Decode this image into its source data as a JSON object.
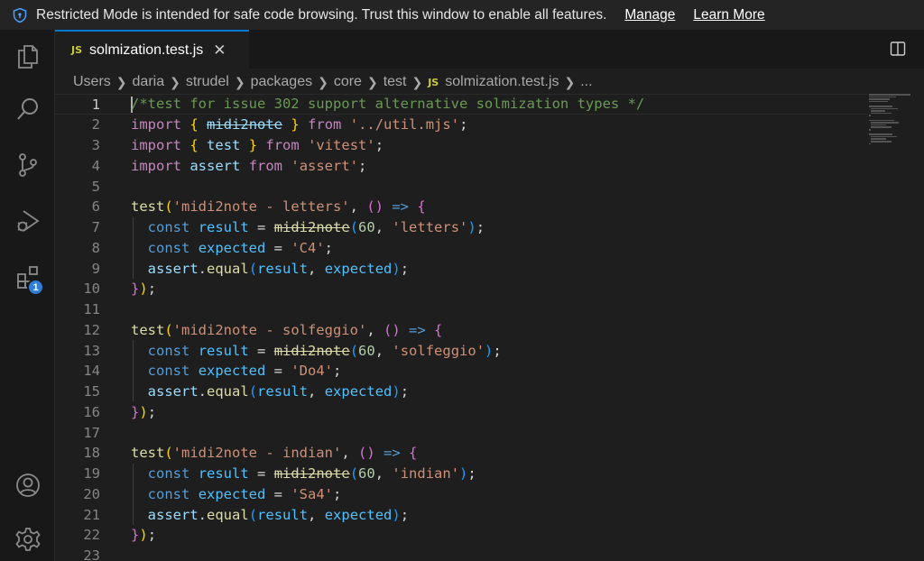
{
  "banner": {
    "message": "Restricted Mode is intended for safe code browsing. Trust this window to enable all features.",
    "manage_label": "Manage",
    "learn_more_label": "Learn More"
  },
  "activity_bar": {
    "extensions_badge": "1",
    "items": [
      "explorer-icon",
      "search-icon",
      "source-control-icon",
      "run-debug-icon",
      "extensions-icon",
      "accounts-icon",
      "settings-gear-icon"
    ]
  },
  "tab": {
    "icon_text": "JS",
    "filename": "solmization.test.js",
    "close_glyph": "✕"
  },
  "breadcrumb": {
    "items": [
      "Users",
      "daria",
      "strudel",
      "packages",
      "core",
      "test"
    ],
    "file_icon": "JS",
    "file": "solmization.test.js",
    "trailing": "..."
  },
  "editor": {
    "line_numbers": [
      "1",
      "2",
      "3",
      "4",
      "5",
      "6",
      "7",
      "8",
      "9",
      "10",
      "11",
      "12",
      "13",
      "14",
      "15",
      "16",
      "17",
      "18",
      "19",
      "20",
      "21",
      "22",
      "23"
    ],
    "lines": [
      [
        [
          "c-cmt",
          "/*test for issue 302 support alternative solmization types */"
        ]
      ],
      [
        [
          "c-kw",
          "import"
        ],
        [
          "c-pl",
          " "
        ],
        [
          "c-br1",
          "{"
        ],
        [
          "c-pl",
          " "
        ],
        [
          "c-var strike",
          "midi2note"
        ],
        [
          "c-pl",
          " "
        ],
        [
          "c-br1",
          "}"
        ],
        [
          "c-pl",
          " "
        ],
        [
          "c-kw",
          "from"
        ],
        [
          "c-pl",
          " "
        ],
        [
          "c-str",
          "'../util.mjs'"
        ],
        [
          "c-pl",
          ";"
        ]
      ],
      [
        [
          "c-kw",
          "import"
        ],
        [
          "c-pl",
          " "
        ],
        [
          "c-br1",
          "{"
        ],
        [
          "c-pl",
          " "
        ],
        [
          "c-var",
          "test"
        ],
        [
          "c-pl",
          " "
        ],
        [
          "c-br1",
          "}"
        ],
        [
          "c-pl",
          " "
        ],
        [
          "c-kw",
          "from"
        ],
        [
          "c-pl",
          " "
        ],
        [
          "c-str",
          "'vitest'"
        ],
        [
          "c-pl",
          ";"
        ]
      ],
      [
        [
          "c-kw",
          "import"
        ],
        [
          "c-pl",
          " "
        ],
        [
          "c-var",
          "assert"
        ],
        [
          "c-pl",
          " "
        ],
        [
          "c-kw",
          "from"
        ],
        [
          "c-pl",
          " "
        ],
        [
          "c-str",
          "'assert'"
        ],
        [
          "c-pl",
          ";"
        ]
      ],
      [],
      [
        [
          "c-fn",
          "test"
        ],
        [
          "c-br1",
          "("
        ],
        [
          "c-str",
          "'midi2note - letters'"
        ],
        [
          "c-pl",
          ", "
        ],
        [
          "c-br2",
          "()"
        ],
        [
          "c-pl",
          " "
        ],
        [
          "c-dec",
          "=>"
        ],
        [
          "c-pl",
          " "
        ],
        [
          "c-br2",
          "{"
        ]
      ],
      [
        [
          "c-pl",
          "  "
        ],
        [
          "c-dec",
          "const"
        ],
        [
          "c-pl",
          " "
        ],
        [
          "c-const",
          "result"
        ],
        [
          "c-pl",
          " = "
        ],
        [
          "c-fn strike",
          "midi2note"
        ],
        [
          "c-br3",
          "("
        ],
        [
          "c-num",
          "60"
        ],
        [
          "c-pl",
          ", "
        ],
        [
          "c-str",
          "'letters'"
        ],
        [
          "c-br3",
          ")"
        ],
        [
          "c-pl",
          ";"
        ]
      ],
      [
        [
          "c-pl",
          "  "
        ],
        [
          "c-dec",
          "const"
        ],
        [
          "c-pl",
          " "
        ],
        [
          "c-const",
          "expected"
        ],
        [
          "c-pl",
          " = "
        ],
        [
          "c-str",
          "'C4'"
        ],
        [
          "c-pl",
          ";"
        ]
      ],
      [
        [
          "c-pl",
          "  "
        ],
        [
          "c-var",
          "assert"
        ],
        [
          "c-pl",
          "."
        ],
        [
          "c-fn",
          "equal"
        ],
        [
          "c-br3",
          "("
        ],
        [
          "c-const",
          "result"
        ],
        [
          "c-pl",
          ", "
        ],
        [
          "c-const",
          "expected"
        ],
        [
          "c-br3",
          ")"
        ],
        [
          "c-pl",
          ";"
        ]
      ],
      [
        [
          "c-br2",
          "}"
        ],
        [
          "c-br1",
          ")"
        ],
        [
          "c-pl",
          ";"
        ]
      ],
      [],
      [
        [
          "c-fn",
          "test"
        ],
        [
          "c-br1",
          "("
        ],
        [
          "c-str",
          "'midi2note - solfeggio'"
        ],
        [
          "c-pl",
          ", "
        ],
        [
          "c-br2",
          "()"
        ],
        [
          "c-pl",
          " "
        ],
        [
          "c-dec",
          "=>"
        ],
        [
          "c-pl",
          " "
        ],
        [
          "c-br2",
          "{"
        ]
      ],
      [
        [
          "c-pl",
          "  "
        ],
        [
          "c-dec",
          "const"
        ],
        [
          "c-pl",
          " "
        ],
        [
          "c-const",
          "result"
        ],
        [
          "c-pl",
          " = "
        ],
        [
          "c-fn strike",
          "midi2note"
        ],
        [
          "c-br3",
          "("
        ],
        [
          "c-num",
          "60"
        ],
        [
          "c-pl",
          ", "
        ],
        [
          "c-str",
          "'solfeggio'"
        ],
        [
          "c-br3",
          ")"
        ],
        [
          "c-pl",
          ";"
        ]
      ],
      [
        [
          "c-pl",
          "  "
        ],
        [
          "c-dec",
          "const"
        ],
        [
          "c-pl",
          " "
        ],
        [
          "c-const",
          "expected"
        ],
        [
          "c-pl",
          " = "
        ],
        [
          "c-str",
          "'Do4'"
        ],
        [
          "c-pl",
          ";"
        ]
      ],
      [
        [
          "c-pl",
          "  "
        ],
        [
          "c-var",
          "assert"
        ],
        [
          "c-pl",
          "."
        ],
        [
          "c-fn",
          "equal"
        ],
        [
          "c-br3",
          "("
        ],
        [
          "c-const",
          "result"
        ],
        [
          "c-pl",
          ", "
        ],
        [
          "c-const",
          "expected"
        ],
        [
          "c-br3",
          ")"
        ],
        [
          "c-pl",
          ";"
        ]
      ],
      [
        [
          "c-br2",
          "}"
        ],
        [
          "c-br1",
          ")"
        ],
        [
          "c-pl",
          ";"
        ]
      ],
      [],
      [
        [
          "c-fn",
          "test"
        ],
        [
          "c-br1",
          "("
        ],
        [
          "c-str",
          "'midi2note - indian'"
        ],
        [
          "c-pl",
          ", "
        ],
        [
          "c-br2",
          "()"
        ],
        [
          "c-pl",
          " "
        ],
        [
          "c-dec",
          "=>"
        ],
        [
          "c-pl",
          " "
        ],
        [
          "c-br2",
          "{"
        ]
      ],
      [
        [
          "c-pl",
          "  "
        ],
        [
          "c-dec",
          "const"
        ],
        [
          "c-pl",
          " "
        ],
        [
          "c-const",
          "result"
        ],
        [
          "c-pl",
          " = "
        ],
        [
          "c-fn strike",
          "midi2note"
        ],
        [
          "c-br3",
          "("
        ],
        [
          "c-num",
          "60"
        ],
        [
          "c-pl",
          ", "
        ],
        [
          "c-str",
          "'indian'"
        ],
        [
          "c-br3",
          ")"
        ],
        [
          "c-pl",
          ";"
        ]
      ],
      [
        [
          "c-pl",
          "  "
        ],
        [
          "c-dec",
          "const"
        ],
        [
          "c-pl",
          " "
        ],
        [
          "c-const",
          "expected"
        ],
        [
          "c-pl",
          " = "
        ],
        [
          "c-str",
          "'Sa4'"
        ],
        [
          "c-pl",
          ";"
        ]
      ],
      [
        [
          "c-pl",
          "  "
        ],
        [
          "c-var",
          "assert"
        ],
        [
          "c-pl",
          "."
        ],
        [
          "c-fn",
          "equal"
        ],
        [
          "c-br3",
          "("
        ],
        [
          "c-const",
          "result"
        ],
        [
          "c-pl",
          ", "
        ],
        [
          "c-const",
          "expected"
        ],
        [
          "c-br3",
          ")"
        ],
        [
          "c-pl",
          ";"
        ]
      ],
      [
        [
          "c-br2",
          "}"
        ],
        [
          "c-br1",
          ")"
        ],
        [
          "c-pl",
          ";"
        ]
      ],
      []
    ],
    "current_line": 1
  },
  "colors": {
    "background": "#1e1e1e",
    "activity_bar": "#181818",
    "accent": "#0078d4",
    "badge": "#2f7fd7",
    "js_icon": "#cbcb41"
  }
}
